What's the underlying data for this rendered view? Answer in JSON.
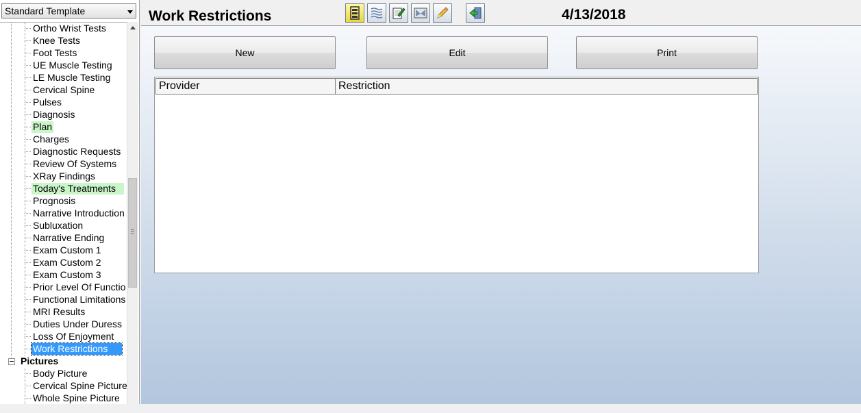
{
  "left": {
    "template_selector": "Standard Template",
    "tree_items": [
      "Ortho Wrist Tests",
      "Knee Tests",
      "Foot Tests",
      "UE Muscle Testing",
      "LE Muscle Testing",
      "Cervical Spine",
      "Pulses",
      "Diagnosis",
      "Plan",
      "Charges",
      "Diagnostic Requests",
      "Review Of Systems",
      "XRay Findings",
      "Today's Treatments",
      "Prognosis",
      "Narrative Introduction",
      "Subluxation",
      "Narrative Ending",
      "Exam Custom 1",
      "Exam Custom 2",
      "Exam Custom 3",
      "Prior Level Of Functio",
      "Functional Limitations",
      "MRI Results",
      "Duties Under Duress",
      "Loss Of Enjoyment",
      "Work Restrictions"
    ],
    "pictures_group": "Pictures",
    "picture_items": [
      "Body Picture",
      "Cervical Spine Picture",
      "Whole Spine Picture"
    ],
    "highlight_color": "#c9f5c9",
    "selected_color": "#3399ff"
  },
  "header": {
    "title": "Work Restrictions",
    "date": "4/13/2018",
    "toolbar_icons": [
      "form-layout-icon",
      "lines-icon",
      "edit-note-icon",
      "image-edit-icon",
      "pencil-icon",
      "exit-door-icon"
    ]
  },
  "actions": {
    "new_label": "New",
    "edit_label": "Edit",
    "print_label": "Print"
  },
  "table": {
    "columns": [
      "Provider",
      "Restriction"
    ],
    "rows": []
  }
}
